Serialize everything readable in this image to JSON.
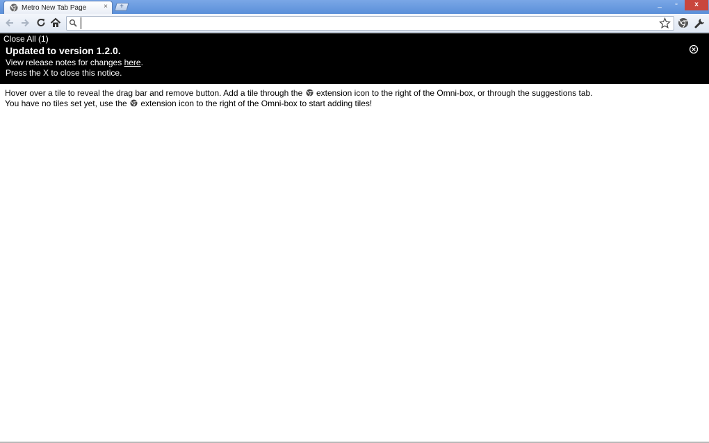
{
  "browser": {
    "tab_title": "Metro New Tab Page",
    "tab_close": "×",
    "new_tab": "+",
    "window_controls": {
      "minimize": "_",
      "restore": "▫",
      "close": "x"
    },
    "omnibox": {
      "value": "",
      "placeholder": ""
    }
  },
  "notice": {
    "close_all_label": "Close All (1)",
    "title": "Updated to version 1.2.0.",
    "line1_prefix": "View release notes for changes ",
    "line1_link": "here",
    "line1_suffix": ".",
    "line2": "Press the X to close this notice."
  },
  "content": {
    "line1_before_icon": "Hover over a tile to reveal the drag bar and remove button. Add a tile through the ",
    "line1_after_icon": " extension icon to the right of the Omni-box, or through the suggestions tab.",
    "line2_before_icon": "You have no tiles set yet, use the ",
    "line2_after_icon": " extension icon to the right of the Omni-box to start adding tiles!"
  },
  "icons": {
    "back": "back-arrow-icon",
    "forward": "forward-arrow-icon",
    "reload": "reload-icon",
    "home": "home-icon",
    "search": "search-icon",
    "star": "star-icon",
    "extension": "chrome-extension-icon",
    "wrench": "wrench-icon",
    "notice_close": "close-circle-icon"
  },
  "colors": {
    "titlebar": "#5a8fd9",
    "notice_bg": "#000000",
    "notice_text": "#ffffff",
    "window_close": "#c9463d"
  }
}
